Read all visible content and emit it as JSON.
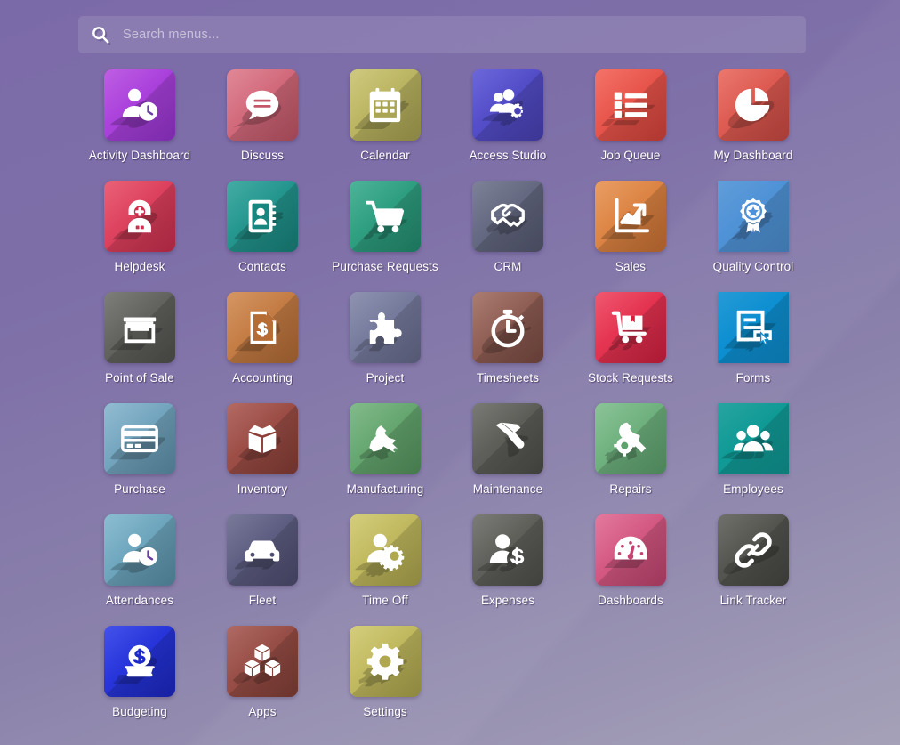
{
  "search": {
    "placeholder": "Search menus...",
    "value": "",
    "icon": "search-icon"
  },
  "theme": {
    "background_top": "#7b6aa8",
    "background_bottom": "#a5a1b8",
    "label_color": "#ffffff",
    "search_field_bg": "rgba(255,255,255,0.115)"
  },
  "apps": [
    {
      "label": "Activity Dashboard",
      "icon": "user-clock-icon",
      "color_from": "#b74ce0",
      "color_to": "#9a34d6",
      "square": false
    },
    {
      "label": "Discuss",
      "icon": "chat-bubble-icon",
      "color_from": "#dd7b8c",
      "color_to": "#c45668",
      "square": false
    },
    {
      "label": "Calendar",
      "icon": "calendar-icon",
      "color_from": "#c9c370",
      "color_to": "#aaa552",
      "square": false
    },
    {
      "label": "Access Studio",
      "icon": "users-gear-icon",
      "color_from": "#5b57d6",
      "color_to": "#4a42b8",
      "square": false
    },
    {
      "label": "Job Queue",
      "icon": "task-list-icon",
      "color_from": "#f36358",
      "color_to": "#d9443c",
      "square": false
    },
    {
      "label": "My Dashboard",
      "icon": "pie-chart-icon",
      "color_from": "#e8695e",
      "color_to": "#cf4a43",
      "square": false
    },
    {
      "label": "Helpdesk",
      "icon": "support-agent-icon",
      "color_from": "#e85069",
      "color_to": "#cf2f4f",
      "square": false
    },
    {
      "label": "Contacts",
      "icon": "address-book-icon",
      "color_from": "#2fa39a",
      "color_to": "#17867f",
      "square": false
    },
    {
      "label": "Purchase Requests",
      "icon": "shopping-cart-icon",
      "color_from": "#3aab8e",
      "color_to": "#229071",
      "square": false
    },
    {
      "label": "CRM",
      "icon": "handshake-icon",
      "color_from": "#70748c",
      "color_to": "#575b73",
      "square": false
    },
    {
      "label": "Sales",
      "icon": "growth-chart-icon",
      "color_from": "#e79353",
      "color_to": "#cf7333",
      "square": false
    },
    {
      "label": "Quality Control",
      "icon": "award-ribbon-icon",
      "color_from": "#4f92d6",
      "color_to": "#4f92d6",
      "square": true
    },
    {
      "label": "Point of Sale",
      "icon": "storefront-icon",
      "color_from": "#6f6f6b",
      "color_to": "#53534f",
      "square": false
    },
    {
      "label": "Accounting",
      "icon": "invoice-dollar-icon",
      "color_from": "#d08a52",
      "color_to": "#b66d35",
      "square": false
    },
    {
      "label": "Project",
      "icon": "puzzle-piece-icon",
      "color_from": "#8287a8",
      "color_to": "#686d8f",
      "square": false
    },
    {
      "label": "Timesheets",
      "icon": "stopwatch-icon",
      "color_from": "#a06e63",
      "color_to": "#7c4c43",
      "square": false
    },
    {
      "label": "Stock Requests",
      "icon": "delivery-cart-icon",
      "color_from": "#ef4560",
      "color_to": "#d61f3f",
      "square": false
    },
    {
      "label": "Forms",
      "icon": "form-cursor-icon",
      "color_from": "#0d8fd1",
      "color_to": "#0d8fd1",
      "square": true
    },
    {
      "label": "Purchase",
      "icon": "credit-card-icon",
      "color_from": "#85b4cc",
      "color_to": "#5f93ae",
      "square": false
    },
    {
      "label": "Inventory",
      "icon": "open-box-icon",
      "color_from": "#aa5a52",
      "color_to": "#8a3e37",
      "square": false
    },
    {
      "label": "Manufacturing",
      "icon": "wrench-icon",
      "color_from": "#74b37e",
      "color_to": "#55975f",
      "square": false
    },
    {
      "label": "Maintenance",
      "icon": "hammer-icon",
      "color_from": "#6b6b66",
      "color_to": "#4e4e4a",
      "square": false
    },
    {
      "label": "Repairs",
      "icon": "wrench-gear-icon",
      "color_from": "#7ebd8c",
      "color_to": "#5ea36e",
      "square": false
    },
    {
      "label": "Employees",
      "icon": "people-group-icon",
      "color_from": "#109a96",
      "color_to": "#109a96",
      "square": true
    },
    {
      "label": "Attendances",
      "icon": "user-clock-icon",
      "color_from": "#7fb6cc",
      "color_to": "#5a93ac",
      "square": false
    },
    {
      "label": "Fleet",
      "icon": "car-icon",
      "color_from": "#6a6a8e",
      "color_to": "#4f4f73",
      "square": false
    },
    {
      "label": "Time Off",
      "icon": "user-gear-icon",
      "color_from": "#cfc86e",
      "color_to": "#b0a84e",
      "square": false
    },
    {
      "label": "Expenses",
      "icon": "user-dollar-icon",
      "color_from": "#6d6d68",
      "color_to": "#50504c",
      "square": false
    },
    {
      "label": "Dashboards",
      "icon": "gauge-icon",
      "color_from": "#e06a92",
      "color_to": "#c44471",
      "square": false
    },
    {
      "label": "Link Tracker",
      "icon": "chain-link-icon",
      "color_from": "#60605b",
      "color_to": "#474743",
      "square": false
    },
    {
      "label": "Budgeting",
      "icon": "coin-deposit-icon",
      "color_from": "#2f3fe8",
      "color_to": "#1c28c9",
      "square": false
    },
    {
      "label": "Apps",
      "icon": "cubes-icon",
      "color_from": "#a65a52",
      "color_to": "#853f37",
      "square": false
    },
    {
      "label": "Settings",
      "icon": "gear-icon",
      "color_from": "#cfc86e",
      "color_to": "#b0a84e",
      "square": false
    }
  ]
}
